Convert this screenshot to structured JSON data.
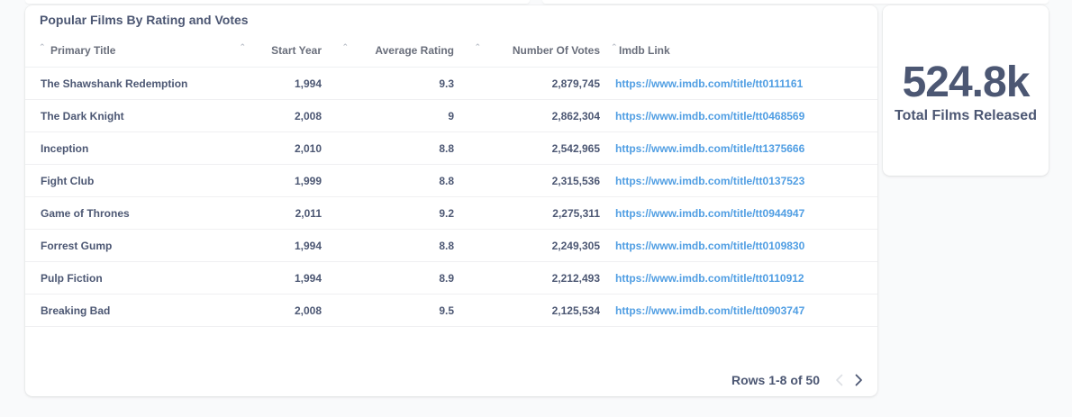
{
  "table_card": {
    "title": "Popular Films By Rating and Votes",
    "columns": {
      "primary_title": "Primary Title",
      "start_year": "Start Year",
      "average_rating": "Average Rating",
      "number_of_votes": "Number Of Votes",
      "imdb_link": "Imdb Link"
    },
    "rows": [
      {
        "title": "The Shawshank Redemption",
        "year": "1,994",
        "rating": "9.3",
        "votes": "2,879,745",
        "link": "https://www.imdb.com/title/tt0111161"
      },
      {
        "title": "The Dark Knight",
        "year": "2,008",
        "rating": "9",
        "votes": "2,862,304",
        "link": "https://www.imdb.com/title/tt0468569"
      },
      {
        "title": "Inception",
        "year": "2,010",
        "rating": "8.8",
        "votes": "2,542,965",
        "link": "https://www.imdb.com/title/tt1375666"
      },
      {
        "title": "Fight Club",
        "year": "1,999",
        "rating": "8.8",
        "votes": "2,315,536",
        "link": "https://www.imdb.com/title/tt0137523"
      },
      {
        "title": "Game of Thrones",
        "year": "2,011",
        "rating": "9.2",
        "votes": "2,275,311",
        "link": "https://www.imdb.com/title/tt0944947"
      },
      {
        "title": "Forrest Gump",
        "year": "1,994",
        "rating": "8.8",
        "votes": "2,249,305",
        "link": "https://www.imdb.com/title/tt0109830"
      },
      {
        "title": "Pulp Fiction",
        "year": "1,994",
        "rating": "8.9",
        "votes": "2,212,493",
        "link": "https://www.imdb.com/title/tt0110912"
      },
      {
        "title": "Breaking Bad",
        "year": "2,008",
        "rating": "9.5",
        "votes": "2,125,534",
        "link": "https://www.imdb.com/title/tt0903747"
      }
    ],
    "footer": {
      "rows_label": "Rows 1-8 of 50",
      "prev_icon": "chevron-left-icon",
      "next_icon": "chevron-right-icon"
    }
  },
  "scalar_card": {
    "value": "524.8k",
    "label": "Total Films Released"
  },
  "colors": {
    "text": "#4c5773",
    "link": "#509ee3",
    "muted": "#b4b9c3",
    "background": "#f9fafb"
  }
}
